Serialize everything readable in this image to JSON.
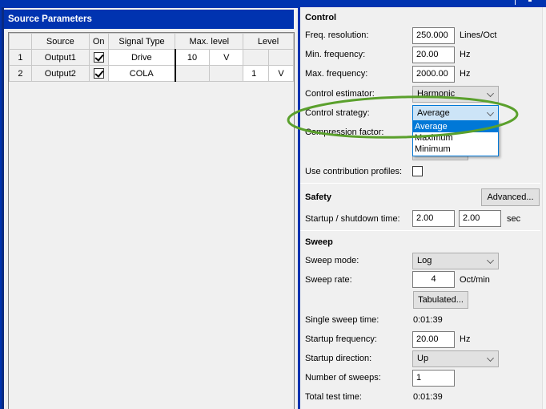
{
  "source_panel": {
    "title": "Source Parameters",
    "columns": [
      "",
      "Source",
      "On",
      "Signal Type",
      "Max. level",
      "Level"
    ],
    "rows": [
      {
        "num": "1",
        "source": "Output1",
        "on": true,
        "signal_type": "Drive",
        "max_level_value": "10",
        "max_level_unit": "V",
        "level_value": "",
        "level_unit": ""
      },
      {
        "num": "2",
        "source": "Output2",
        "on": true,
        "signal_type": "COLA",
        "max_level_value": "",
        "max_level_unit": "",
        "level_value": "1",
        "level_unit": "V"
      }
    ]
  },
  "control": {
    "title": "Control",
    "freq_resolution": {
      "label": "Freq. resolution:",
      "value": "250.000",
      "unit": "Lines/Oct"
    },
    "min_frequency": {
      "label": "Min. frequency:",
      "value": "20.00",
      "unit": "Hz"
    },
    "max_frequency": {
      "label": "Max. frequency:",
      "value": "2000.00",
      "unit": "Hz"
    },
    "control_estimator": {
      "label": "Control estimator:",
      "value": "Harmonic"
    },
    "control_strategy": {
      "label": "Control strategy:",
      "value": "Average",
      "options": [
        "Average",
        "Maximum",
        "Minimum"
      ],
      "highlighted": "Average"
    },
    "compression_factor": {
      "label": "Compression factor:"
    },
    "use_contribution_profiles": {
      "label": "Use contribution profiles:",
      "checked": false
    }
  },
  "safety": {
    "title": "Safety",
    "advanced_button": "Advanced...",
    "startup_shutdown": {
      "label": "Startup / shutdown time:",
      "startup_value": "2.00",
      "shutdown_value": "2.00",
      "unit": "sec"
    }
  },
  "sweep": {
    "title": "Sweep",
    "sweep_mode": {
      "label": "Sweep mode:",
      "value": "Log"
    },
    "sweep_rate": {
      "label": "Sweep rate:",
      "value": "4",
      "unit": "Oct/min"
    },
    "tabulated_button": "Tabulated...",
    "single_sweep_time": {
      "label": "Single sweep time:",
      "value": "0:01:39"
    },
    "startup_frequency": {
      "label": "Startup frequency:",
      "value": "20.00",
      "unit": "Hz"
    },
    "startup_direction": {
      "label": "Startup direction:",
      "value": "Up"
    },
    "number_of_sweeps": {
      "label": "Number of sweeps:",
      "value": "1"
    },
    "total_test_time": {
      "label": "Total test time:",
      "value": "0:01:39"
    }
  },
  "annotation": {
    "color": "#5aa02c",
    "target": "control-strategy"
  }
}
